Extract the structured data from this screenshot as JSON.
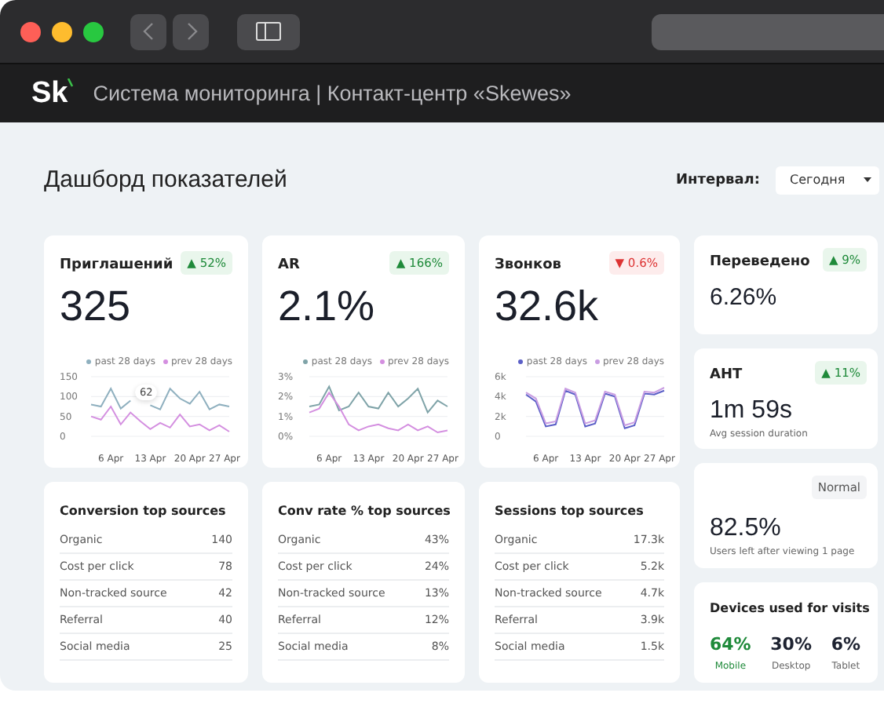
{
  "app_header": {
    "logo": "Sk",
    "title": "Система мониторинга | Контакт-центр «Skewes»"
  },
  "page": {
    "title": "Дашборд показателей",
    "interval_label": "Интервал:",
    "interval_value": "Сегодня"
  },
  "chart_cards": [
    {
      "title": "Приглашений",
      "badge": {
        "kind": "up",
        "text": "▲ 52%"
      },
      "value": "325",
      "tooltip": "62",
      "chart_data": {
        "type": "line",
        "categories": [
          null,
          null,
          "6 Apr",
          null,
          null,
          null,
          "13 Apr",
          null,
          null,
          null,
          "20 Apr",
          null,
          null,
          null,
          "27 Apr"
        ],
        "ylim": [
          0,
          150
        ],
        "yticks": [
          0,
          50,
          100,
          150
        ],
        "series": [
          {
            "name": "past 28 days",
            "color": "#8fb0bf",
            "values": [
              80,
              75,
              120,
              70,
              90,
              null,
              78,
              68,
              120,
              95,
              82,
              112,
              68,
              80,
              75
            ]
          },
          {
            "name": "prev 28 days",
            "color": "#d48fe0",
            "values": [
              50,
              42,
              75,
              30,
              60,
              38,
              18,
              34,
              22,
              55,
              25,
              30,
              15,
              28,
              12
            ]
          }
        ]
      }
    },
    {
      "title": "AR",
      "badge": {
        "kind": "up",
        "text": "▲ 166%"
      },
      "value": "2.1%",
      "chart_data": {
        "type": "line",
        "categories": [
          null,
          null,
          "6 Apr",
          null,
          null,
          null,
          "13 Apr",
          null,
          null,
          null,
          "20 Apr",
          null,
          null,
          null,
          "27 Apr"
        ],
        "ylim": [
          0,
          3
        ],
        "yticks": [
          {
            "value": 0,
            "label": "0%"
          },
          {
            "value": 1,
            "label": "1%"
          },
          {
            "value": 2,
            "label": "2%"
          },
          {
            "value": 3,
            "label": "3%"
          }
        ],
        "series": [
          {
            "name": "past 28 days",
            "color": "#7fa3a8",
            "values": [
              1.5,
              1.6,
              2.5,
              1.3,
              1.5,
              2.2,
              1.5,
              1.4,
              2.2,
              1.5,
              1.9,
              2.4,
              1.2,
              1.8,
              1.5
            ]
          },
          {
            "name": "prev 28 days",
            "color": "#d48fe0",
            "values": [
              1.2,
              1.4,
              2.2,
              1.5,
              0.6,
              0.3,
              0.5,
              0.6,
              0.4,
              0.3,
              0.6,
              0.3,
              0.5,
              0.2,
              0.3
            ]
          }
        ]
      }
    },
    {
      "title": "Звонков",
      "badge": {
        "kind": "down",
        "text": "▼ 0.6%"
      },
      "value": "32.6k",
      "chart_data": {
        "type": "line",
        "categories": [
          null,
          null,
          "6 Apr",
          null,
          null,
          null,
          "13 Apr",
          null,
          null,
          null,
          "20 Apr",
          null,
          null,
          null,
          "27 Apr"
        ],
        "ylim": [
          0,
          6
        ],
        "yticks": [
          {
            "value": 0,
            "label": "0"
          },
          {
            "value": 2,
            "label": "2k"
          },
          {
            "value": 4,
            "label": "4k"
          },
          {
            "value": 6,
            "label": "6k"
          }
        ],
        "series": [
          {
            "name": "past 28 days",
            "color": "#5b5fc7",
            "values": [
              4.2,
              3.5,
              1,
              1.2,
              4.6,
              4.2,
              1,
              1.3,
              4.3,
              4,
              0.8,
              1.1,
              4.3,
              4.2,
              4.6
            ]
          },
          {
            "name": "prev 28 days",
            "color": "#c99de2",
            "values": [
              4.4,
              3.8,
              1.3,
              1.5,
              4.8,
              4.4,
              1.3,
              1.6,
              4.5,
              4.2,
              1.1,
              1.4,
              4.5,
              4.4,
              4.9
            ]
          }
        ]
      }
    }
  ],
  "source_tables": [
    {
      "title": "Conversion top sources",
      "rows": [
        {
          "label": "Organic",
          "value": "140"
        },
        {
          "label": "Cost per click",
          "value": "78"
        },
        {
          "label": "Non-tracked source",
          "value": "42"
        },
        {
          "label": "Referral",
          "value": "40"
        },
        {
          "label": "Social media",
          "value": "25"
        }
      ]
    },
    {
      "title": "Conv rate % top sources",
      "rows": [
        {
          "label": "Organic",
          "value": "43%"
        },
        {
          "label": "Cost per click",
          "value": "24%"
        },
        {
          "label": "Non-tracked source",
          "value": "13%"
        },
        {
          "label": "Referral",
          "value": "12%"
        },
        {
          "label": "Social media",
          "value": "8%"
        }
      ]
    },
    {
      "title": "Sessions top sources",
      "rows": [
        {
          "label": "Organic",
          "value": "17.3k"
        },
        {
          "label": "Cost per click",
          "value": "5.2k"
        },
        {
          "label": "Non-tracked source",
          "value": "4.7k"
        },
        {
          "label": "Referral",
          "value": "3.9k"
        },
        {
          "label": "Social media",
          "value": "1.5k"
        }
      ]
    }
  ],
  "side_cards": [
    {
      "kind": "stat",
      "title": "Переведено",
      "badge": {
        "kind": "up",
        "text": "▲ 9%"
      },
      "value": "6.26%"
    },
    {
      "kind": "stat",
      "title": "AHT",
      "badge": {
        "kind": "up",
        "text": "▲ 11%"
      },
      "value": "1m 59s",
      "caption": "Avg session duration"
    },
    {
      "kind": "stat",
      "badge": {
        "kind": "neutral",
        "text": "Normal"
      },
      "value": "82.5%",
      "caption": "Users left after viewing 1 page"
    },
    {
      "kind": "devices",
      "title": "Devices used for visits",
      "devices": [
        {
          "value": "64%",
          "label": "Mobile",
          "color": "#1f8a3a"
        },
        {
          "value": "30%",
          "label": "Desktop",
          "color": "#1d2230"
        },
        {
          "value": "6%",
          "label": "Tablet",
          "color": "#1d2230"
        }
      ]
    }
  ]
}
